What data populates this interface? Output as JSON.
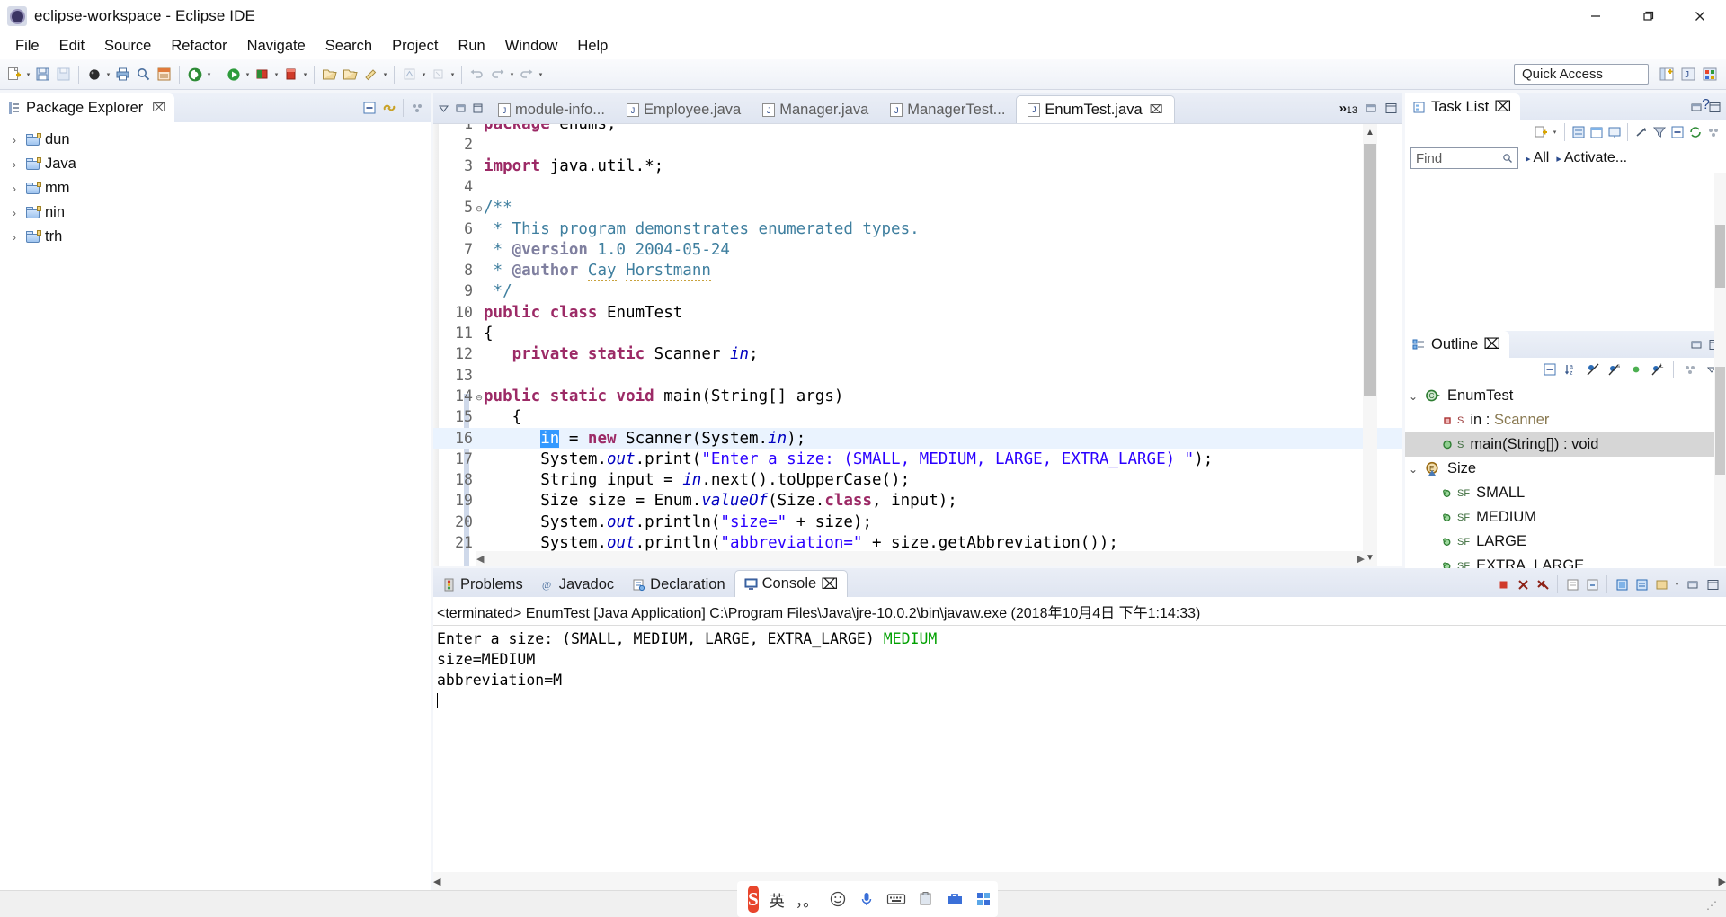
{
  "window": {
    "title": "eclipse-workspace - Eclipse IDE",
    "app_icon": "eclipse-icon",
    "minimize_label": "—",
    "maximize_label": "□",
    "close_label": "✕"
  },
  "menu": {
    "items": [
      "File",
      "Edit",
      "Source",
      "Refactor",
      "Navigate",
      "Search",
      "Project",
      "Run",
      "Window",
      "Help"
    ]
  },
  "toolbar": {
    "quick_access_placeholder": "Quick Access",
    "quick_access_value": "Quick Access"
  },
  "package_explorer": {
    "title": "Package Explorer",
    "close_label": "⌧",
    "items": [
      {
        "label": "dun",
        "twisty": "›",
        "icon": "package-folder-icon"
      },
      {
        "label": "Java",
        "twisty": "›",
        "icon": "package-folder-icon"
      },
      {
        "label": "mm",
        "twisty": "›",
        "icon": "package-folder-icon"
      },
      {
        "label": "nin",
        "twisty": "›",
        "icon": "package-folder-icon"
      },
      {
        "label": "trh",
        "twisty": "›",
        "icon": "package-folder-icon"
      }
    ]
  },
  "editor": {
    "tabs": [
      {
        "label": "module-info...",
        "active": false
      },
      {
        "label": "Employee.java",
        "active": false
      },
      {
        "label": "Manager.java",
        "active": false
      },
      {
        "label": "ManagerTest...",
        "active": false
      },
      {
        "label": "EnumTest.java",
        "active": true
      }
    ],
    "overflow_chevron": "»",
    "overflow_count": "13",
    "minimize_label": "—",
    "maximize_label": "□",
    "close_label": "⌧",
    "lines": [
      {
        "n": "1",
        "fold": "",
        "text": "package enums;",
        "clipped": true
      },
      {
        "n": "2",
        "fold": "",
        "text": ""
      },
      {
        "n": "3",
        "fold": "",
        "text": "import java.util.*;"
      },
      {
        "n": "4",
        "fold": "",
        "text": ""
      },
      {
        "n": "5",
        "fold": "⊖",
        "text": "/**"
      },
      {
        "n": "6",
        "fold": "",
        "text": " * This program demonstrates enumerated types."
      },
      {
        "n": "7",
        "fold": "",
        "text": " * @version 1.0 2004-05-24"
      },
      {
        "n": "8",
        "fold": "",
        "text": " * @author Cay Horstmann"
      },
      {
        "n": "9",
        "fold": "",
        "text": " */"
      },
      {
        "n": "10",
        "fold": "",
        "text": "public class EnumTest"
      },
      {
        "n": "11",
        "fold": "",
        "text": "{"
      },
      {
        "n": "12",
        "fold": "",
        "text": "   private static Scanner in;"
      },
      {
        "n": "13",
        "fold": "",
        "text": ""
      },
      {
        "n": "14",
        "fold": "⊖",
        "text": "public static void main(String[] args)"
      },
      {
        "n": "15",
        "fold": "",
        "text": "   {"
      },
      {
        "n": "16",
        "fold": "",
        "text": "      in = new Scanner(System.in);",
        "current": true
      },
      {
        "n": "17",
        "fold": "",
        "text": "      System.out.print(\"Enter a size: (SMALL, MEDIUM, LARGE, EXTRA_LARGE) \");"
      },
      {
        "n": "18",
        "fold": "",
        "text": "      String input = in.next().toUpperCase();"
      },
      {
        "n": "19",
        "fold": "",
        "text": "      Size size = Enum.valueOf(Size.class, input);"
      },
      {
        "n": "20",
        "fold": "",
        "text": "      System.out.println(\"size=\" + size);"
      },
      {
        "n": "21",
        "fold": "",
        "text": "      System.out.println(\"abbreviation=\" + size.getAbbreviation());"
      }
    ],
    "selected_token": "in"
  },
  "task_list": {
    "title": "Task List",
    "close_label": "⌧",
    "find_placeholder": "Find",
    "find_value": "Find",
    "all_label": "All",
    "activate_label": "Activate...",
    "help_label": "?",
    "minimize_label": "—",
    "maximize_label": "□"
  },
  "outline": {
    "title": "Outline",
    "close_label": "⌧",
    "minimize_label": "—",
    "maximize_label": "□",
    "items": [
      {
        "label": "EnumTest",
        "twisty": "⌄",
        "icon": "class-icon",
        "indent": 0,
        "selected": false,
        "modifier": ""
      },
      {
        "label": "in : Scanner",
        "twisty": "",
        "icon": "field-private-icon",
        "indent": 1,
        "selected": false,
        "modifier": "S"
      },
      {
        "label": "main(String[]) : void",
        "twisty": "",
        "icon": "method-public-icon",
        "indent": 1,
        "selected": true,
        "modifier": "S"
      },
      {
        "label": "Size",
        "twisty": "⌄",
        "icon": "enum-icon",
        "indent": 0,
        "selected": false,
        "modifier": ""
      },
      {
        "label": "SMALL",
        "twisty": "",
        "icon": "enum-constant-icon",
        "indent": 1,
        "selected": false,
        "modifier": "SF"
      },
      {
        "label": "MEDIUM",
        "twisty": "",
        "icon": "enum-constant-icon",
        "indent": 1,
        "selected": false,
        "modifier": "SF"
      },
      {
        "label": "LARGE",
        "twisty": "",
        "icon": "enum-constant-icon",
        "indent": 1,
        "selected": false,
        "modifier": "SF"
      },
      {
        "label": "EXTRA_LARGE",
        "twisty": "",
        "icon": "enum-constant-icon",
        "indent": 1,
        "selected": false,
        "modifier": "SF"
      }
    ]
  },
  "bottom": {
    "tabs": [
      {
        "label": "Problems",
        "active": false,
        "icon": "problems-icon"
      },
      {
        "label": "Javadoc",
        "active": false,
        "icon": "javadoc-icon"
      },
      {
        "label": "Declaration",
        "active": false,
        "icon": "declaration-icon"
      },
      {
        "label": "Console",
        "active": true,
        "icon": "console-icon"
      }
    ],
    "close_label": "⌧",
    "console_header": "<terminated> EnumTest [Java Application] C:\\Program Files\\Java\\jre-10.0.2\\bin\\javaw.exe (2018年10月4日 下午1:14:33)",
    "console_lines": [
      {
        "text": "Enter a size: (SMALL, MEDIUM, LARGE, EXTRA_LARGE) ",
        "input": "MEDIUM"
      },
      {
        "text": "size=MEDIUM",
        "input": ""
      },
      {
        "text": "abbreviation=M",
        "input": ""
      }
    ],
    "input_color": "#00a000"
  },
  "ime": {
    "logo": "S",
    "mode_label": "英",
    "punct_label": "，。",
    "items": [
      "smiley-icon",
      "microphone-icon",
      "keyboard-icon",
      "clipboard-icon",
      "toolbox-icon",
      "apps-icon"
    ]
  },
  "colors": {
    "keyword": "#9c2a66",
    "comment": "#3f7f9f",
    "string": "#2a00ff",
    "field": "#0000c0",
    "selection": "#3399ff",
    "current_line": "#eaf3fe",
    "console_input": "#00a000"
  }
}
